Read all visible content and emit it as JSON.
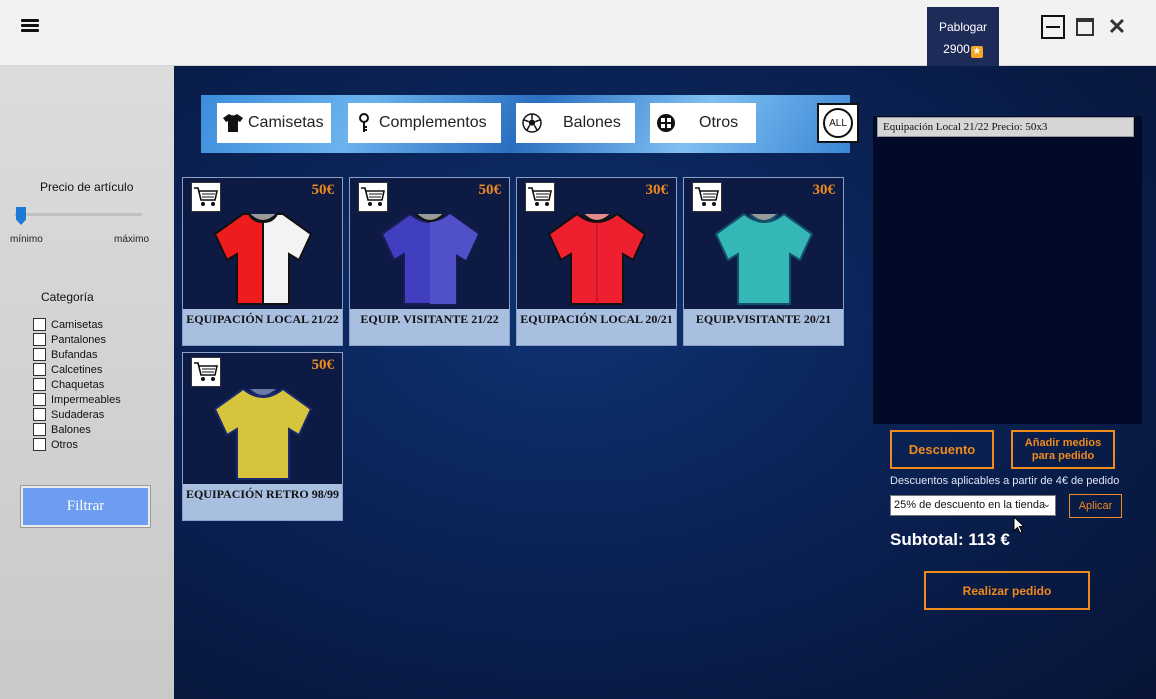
{
  "topbar": {
    "user_name": "Pablogar",
    "points": "2900",
    "menu_icon": "hamburger-icon",
    "window_buttons": [
      "minimize-icon",
      "maximize-icon",
      "close-icon"
    ],
    "close_glyph": "✕"
  },
  "sidebar": {
    "price_label": "Precio de artículo",
    "slider_min": "mínimo",
    "slider_max": "máximo",
    "category_label": "Categoría",
    "categories": [
      "Camisetas",
      "Pantalones",
      "Bufandas",
      "Calcetines",
      "Chaquetas",
      "Impermeables",
      "Sudaderas",
      "Balones",
      "Otros"
    ],
    "filter_label": "Filtrar"
  },
  "category_bar": {
    "buttons": [
      {
        "label": "Camisetas",
        "icon": "tshirt-icon"
      },
      {
        "label": "Complementos",
        "icon": "key-icon"
      },
      {
        "label": "Balones",
        "icon": "soccer-ball-icon"
      },
      {
        "label": "Otros",
        "icon": "grid-circle-icon"
      }
    ],
    "all_label": "ALL"
  },
  "products": [
    {
      "name": "EQUIPACIÓN LOCAL 21/22",
      "price": "50€",
      "colors": [
        "#ee1c1c",
        "#f3f3f3"
      ]
    },
    {
      "name": "EQUIP. VISITANTE 21/22",
      "price": "50€",
      "colors": [
        "#3f3fbf",
        "#5050c8"
      ]
    },
    {
      "name": "EQUIPACIÓN LOCAL 20/21",
      "price": "30€",
      "colors": [
        "#ee2030",
        "#ee2030"
      ]
    },
    {
      "name": "EQUIP.VISITANTE 20/21",
      "price": "30€",
      "colors": [
        "#36b7b7",
        "#36b7b7"
      ]
    },
    {
      "name": "EQUIPACIÓN RETRO 98/99",
      "price": "50€",
      "colors": [
        "#d6c43c",
        "#d6c43c"
      ]
    }
  ],
  "cart": {
    "line": "Equipación Local 21/22 Precio: 50x3",
    "discount_button": "Descuento",
    "add_button": "Añadir medios para pedido",
    "discount_note": "Descuentos aplicables a partir de 4€ de pedido",
    "discount_selected": "25% de descuento en la tienda",
    "apply_button": "Aplicar",
    "subtotal": "Subtotal: 113 €",
    "order_button": "Realizar pedido"
  }
}
